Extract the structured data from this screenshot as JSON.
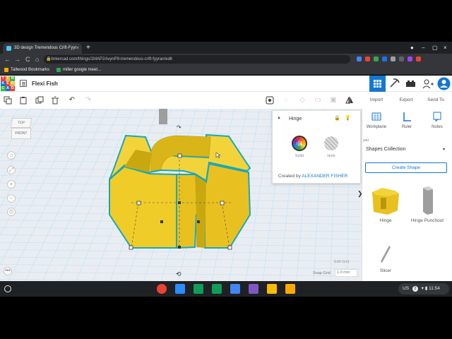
{
  "browser": {
    "tab_title": "3D design Tremendous Crift-Fyyr",
    "tab_close": "×",
    "new_tab": "+",
    "url": "tinkercad.com/things/1MAP2AvynP9-tremendous-crift-fyyran/edit",
    "nav": {
      "back": "←",
      "forward": "→",
      "reload": "C",
      "home": "⌂"
    },
    "bookmarks": [
      {
        "label": "Tallwood Bookmarks",
        "color": "#f9ab00"
      },
      {
        "label": "miller google meet...",
        "color": "#34a853"
      }
    ],
    "window_controls": {
      "minimize": "–",
      "maximize": "▢",
      "close": "×",
      "record": "●"
    },
    "extension_colors": [
      "#4285f4",
      "#ea4335",
      "#34a853",
      "#1a73e8",
      "#9aa0a6",
      "#5f6368",
      "#a142f4",
      "#ea4335"
    ]
  },
  "header": {
    "logo_letters": [
      "T",
      "I",
      "N",
      "K",
      "E",
      "R",
      "C",
      "A",
      "D"
    ],
    "logo_colors": [
      "#e8403a",
      "#f0b33c",
      "#3db44b",
      "#1477d1",
      "#e8403a",
      "#f0b33c",
      "#3db44b",
      "#1477d1",
      "#e8403a"
    ],
    "design_title": "Flexi Fish",
    "accent": "#1477d1"
  },
  "toolbar": {
    "tools": [
      {
        "name": "copy",
        "glyph": "⧉"
      },
      {
        "name": "paste",
        "glyph": "📋"
      },
      {
        "name": "duplicate",
        "glyph": "❐"
      },
      {
        "name": "delete",
        "glyph": "🗑"
      },
      {
        "name": "undo",
        "glyph": "↶"
      },
      {
        "name": "redo",
        "glyph": "↷"
      }
    ],
    "right_tools": [
      {
        "name": "note",
        "glyph": "⌂"
      },
      {
        "name": "light",
        "glyph": "◌"
      },
      {
        "name": "group",
        "glyph": "◇"
      },
      {
        "name": "align",
        "glyph": "▭"
      },
      {
        "name": "ungroup",
        "glyph": "▣"
      },
      {
        "name": "mirror",
        "glyph": "⊞"
      },
      {
        "name": "flip",
        "glyph": "⊿"
      }
    ],
    "import_label": "Import",
    "export_label": "Export",
    "send_to_label": "Send To"
  },
  "viewcube": {
    "top": "TOP",
    "front": "FRONT"
  },
  "nav_controls": [
    "⌂",
    "⤢",
    "+",
    "–",
    "⊙"
  ],
  "more_label": "•••",
  "inspector": {
    "title": "Hinge",
    "collapse": "▲",
    "lock": "🔒",
    "light": "💡",
    "solid_label": "Solid",
    "hole_label": "Hole",
    "created_by_prefix": "Created by",
    "author": "ALEXANDER FISHER"
  },
  "workplane": {
    "edit_grid": "Edit Grid",
    "snap_grid_label": "Snap Grid",
    "snap_grid_value": "1.0 mm",
    "view_arrow": "↷",
    "rotate_arrow": "⟲",
    "shape_color": "#f2d43a",
    "outline_color": "#1ba8b8"
  },
  "right_panel": {
    "tools": [
      {
        "label": "Workplane"
      },
      {
        "label": "Ruler"
      },
      {
        "label": "Notes"
      }
    ],
    "library_source": "you",
    "library_name": "Shapes Collection",
    "library_caret": "▾",
    "create_shape": "Create Shape",
    "collapse": "❯",
    "shapes": [
      {
        "label": "Hinge"
      },
      {
        "label": "Hinge Punchout"
      },
      {
        "label": "Slicer"
      }
    ]
  },
  "shelf": {
    "app_colors": [
      "#ea4335",
      "#2d8cff",
      "#0f9d58",
      "#0f9d58",
      "#4285f4",
      "#7e57c2",
      "#fbbc04",
      "#f9ab00"
    ],
    "tray": {
      "locale": "US",
      "badge": "2",
      "time": "11:54"
    }
  }
}
